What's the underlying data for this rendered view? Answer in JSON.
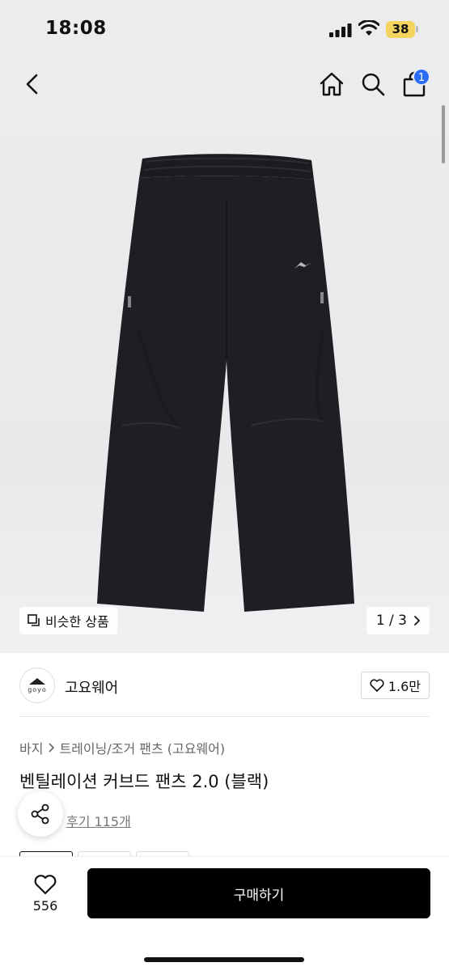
{
  "status_bar": {
    "time": "18:08",
    "battery": "38"
  },
  "nav": {
    "back_icon": "chevron-left-icon",
    "home_icon": "home-icon",
    "search_icon": "search-icon",
    "cart_icon": "shopping-bag-icon",
    "cart_count": "1"
  },
  "gallery": {
    "similar_label": "비슷한 상품",
    "page_indicator": "1 / 3"
  },
  "brand": {
    "logo_text": "goyo",
    "name": "고요웨어",
    "likes": "1.6만"
  },
  "product": {
    "breadcrumb": [
      "바지",
      "트레이닝/조거 팬츠 (고요웨어)"
    ],
    "title": "벤틸레이션 커브드 팬츠 2.0 (블랙)",
    "reviews": "후기 115개"
  },
  "bottom_bar": {
    "wishlist_count": "556",
    "buy_label": "구매하기"
  },
  "colors": {
    "accent": "#2a6cf6",
    "buy_button": "#000000",
    "battery": "#f4d35e"
  }
}
